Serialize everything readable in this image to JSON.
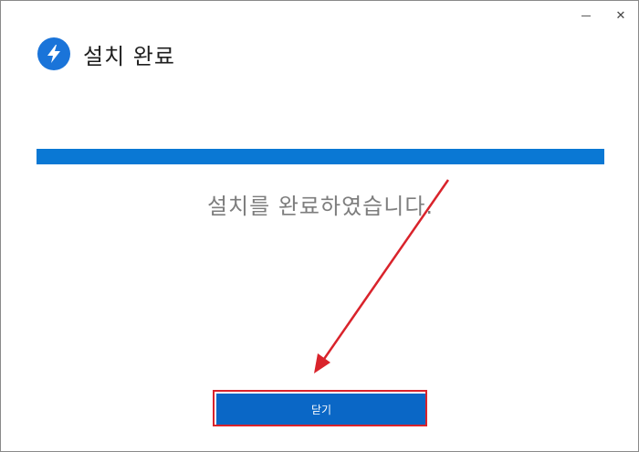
{
  "window": {
    "controls": {
      "close_glyph": "✕"
    }
  },
  "header": {
    "icon": "lightning-bolt-icon",
    "title": "설치 완료"
  },
  "progress": {
    "value": 100
  },
  "status": {
    "message": "설치를 완료하였습니다."
  },
  "actions": {
    "close_label": "닫기"
  },
  "colors": {
    "accent": "#0a78d4",
    "button": "#0a67c6",
    "annotation": "#d9232b"
  }
}
